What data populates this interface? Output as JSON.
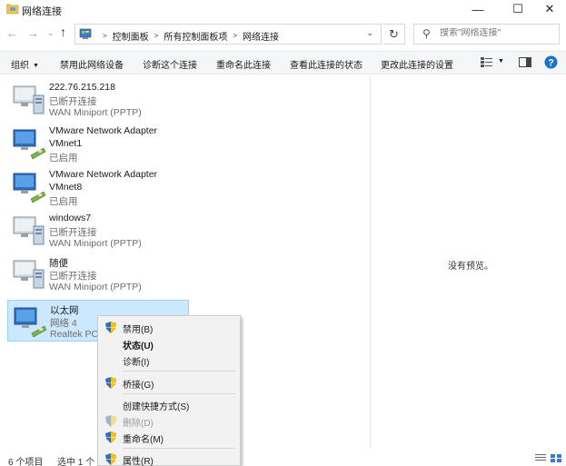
{
  "window": {
    "title": "网络连接",
    "icon": "network-folder-icon",
    "controls": {
      "minimize": "—",
      "maximize": "☐",
      "close": "✕"
    }
  },
  "nav": {
    "back": "←",
    "forward": "→",
    "recent": "⌄",
    "up": "↑"
  },
  "address": {
    "breadcrumbs": [
      "控制面板",
      "所有控制面板项",
      "网络连接"
    ],
    "dropdown": "⌄",
    "refresh": "↻"
  },
  "search": {
    "placeholder": "搜索\"网络连接\""
  },
  "commandbar": {
    "organize": "组织",
    "disable": "禁用此网络设备",
    "diagnose": "诊断这个连接",
    "rename": "重命名此连接",
    "view_status": "查看此连接的状态",
    "change_settings": "更改此连接的设置"
  },
  "connections": [
    {
      "name": "222.76.215.218",
      "status": "已断开连接",
      "device": "WAN Miniport (PPTP)",
      "kind": "wan"
    },
    {
      "name": "VMware Network Adapter",
      "status": "VMnet1",
      "device": "已启用",
      "kind": "lan"
    },
    {
      "name": "VMware Network Adapter",
      "status": "VMnet8",
      "device": "已启用",
      "kind": "lan"
    },
    {
      "name": "windows7",
      "status": "已断开连接",
      "device": "WAN Miniport (PPTP)",
      "kind": "wan"
    },
    {
      "name": "随便",
      "status": "已断开连接",
      "device": "WAN Miniport (PPTP)",
      "kind": "wan"
    },
    {
      "name": "以太网",
      "status": "网络 4",
      "device": "Realtek PCI",
      "kind": "lan",
      "selected": true
    }
  ],
  "preview": {
    "empty_text": "没有预览。"
  },
  "context_menu": {
    "items": [
      {
        "label": "禁用(B)",
        "shield": true
      },
      {
        "label": "状态(U)",
        "bold": true
      },
      {
        "label": "诊断(I)"
      },
      {
        "label": "桥接(G)",
        "shield": true
      },
      {
        "label": "创建快捷方式(S)"
      },
      {
        "label": "删除(D)",
        "shield": true,
        "disabled": true
      },
      {
        "label": "重命名(M)",
        "shield": true
      },
      {
        "label": "属性(R)",
        "shield": true
      }
    ]
  },
  "statusbar": {
    "count": "6 个项目",
    "selected": "选中 1 个"
  },
  "colors": {
    "selection_bg": "#cce8ff",
    "selection_border": "#99d1ff",
    "help_blue": "#1a73c9",
    "shield_blue": "#2a6fc9",
    "shield_yellow": "#f2c21b"
  }
}
